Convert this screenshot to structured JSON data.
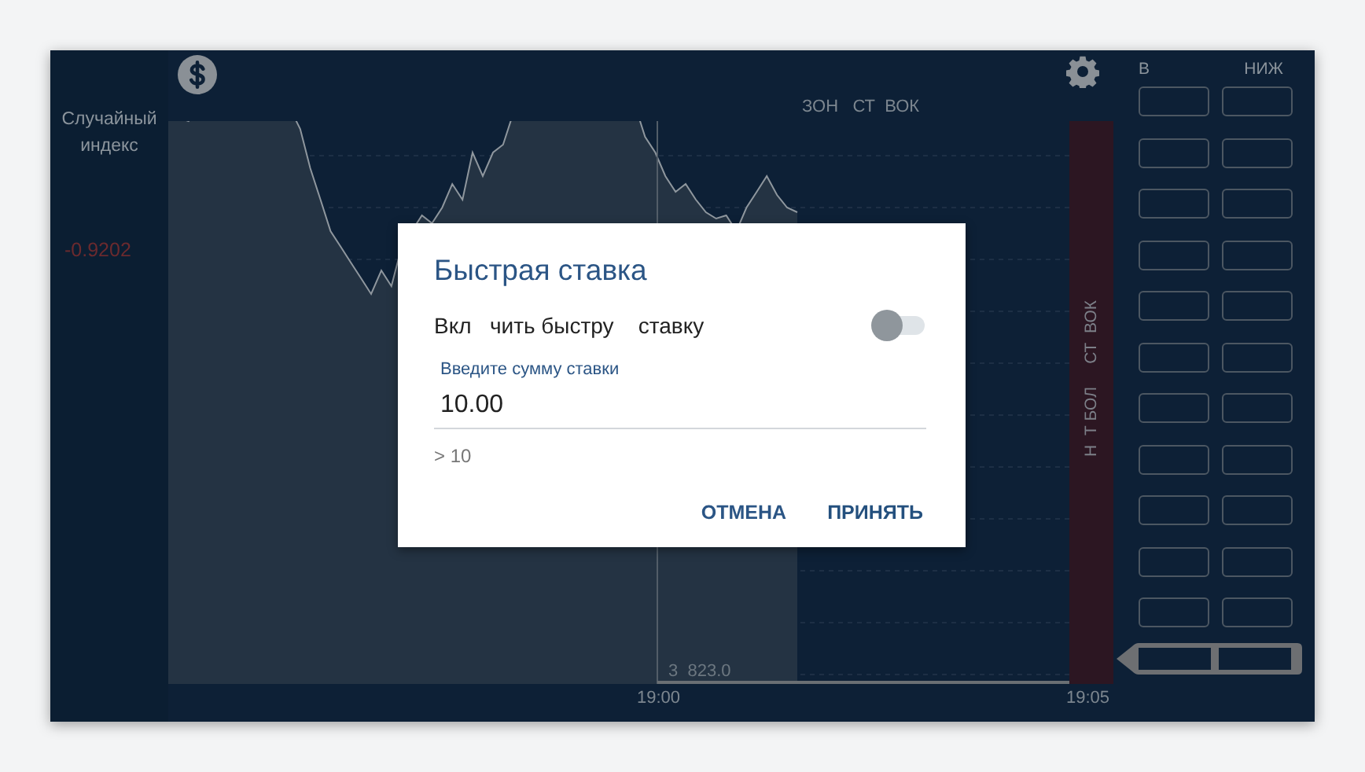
{
  "instrument": {
    "name": "Случайный индекс",
    "change": "-0.9202"
  },
  "header": {
    "zone_label": "ЗОН   СТ  ВОК"
  },
  "chart": {
    "price_label": "3  823.0",
    "times": [
      "19:00",
      "19:05"
    ],
    "band_label": "Н  Т БОЛ     СТ  ВОК"
  },
  "bets": {
    "columns": [
      "В",
      "НИЖ"
    ]
  },
  "dialog": {
    "title": "Быстрая ставка",
    "toggle": {
      "label": "Вкл   чить быстру    ставку",
      "on": false
    },
    "amount": {
      "label": "Введите сумму ставки",
      "value": "10.00",
      "hint": "> 10"
    },
    "buttons": [
      {
        "label": "ОТМЕНА",
        "kind": "cancel"
      },
      {
        "label": "ПРИНЯТЬ",
        "kind": "accept"
      }
    ]
  }
}
